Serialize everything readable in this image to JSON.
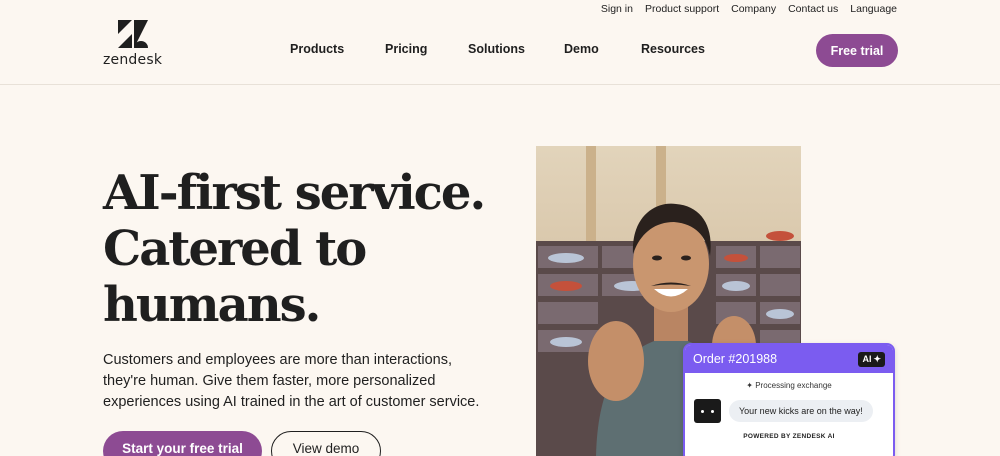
{
  "brand": {
    "name": "zendesk"
  },
  "utility_nav": [
    "Sign in",
    "Product support",
    "Company",
    "Contact us",
    "Language"
  ],
  "main_nav": {
    "products": "Products",
    "pricing": "Pricing",
    "solutions": "Solutions",
    "demo": "Demo",
    "resources": "Resources"
  },
  "header": {
    "cta": "Free trial"
  },
  "hero": {
    "title_line1": "AI-first service.",
    "title_line2": "Catered to",
    "title_line3": "humans.",
    "subtitle": "Customers and employees are more than interactions, they're human. Give them faster, more personalized experiences using AI trained in the art of customer service.",
    "primary_cta": "Start your free trial",
    "secondary_cta": "View demo"
  },
  "order_card": {
    "title": "Order #201988",
    "badge": "AI",
    "status": "Processing exchange",
    "message": "Your new kicks are on the way!",
    "footer": "POWERED BY ZENDESK AI"
  },
  "colors": {
    "background": "#fcf7f1",
    "brand_purple": "#8d4b93",
    "card_accent": "#7b5cf0",
    "text": "#1f1f1f"
  }
}
